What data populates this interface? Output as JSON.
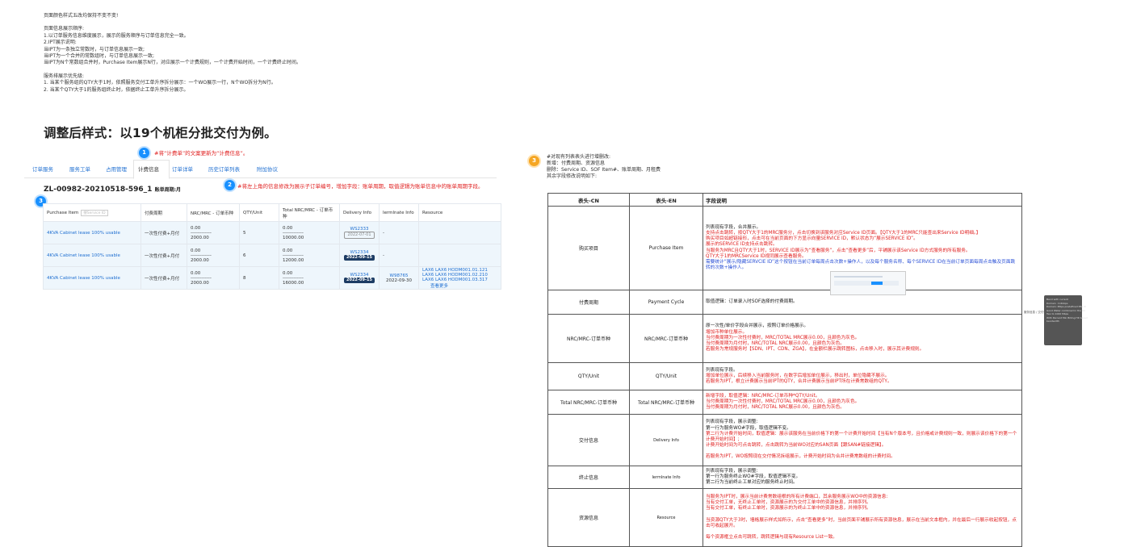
{
  "notes": {
    "line1": "页面颜色样式五改均保持不变不变!",
    "blank1": "",
    "line2": "页面信息展示顺序:",
    "line3": "1.以订单服务信息维度展示，展示的服务顺序与订单信息完全一致。",
    "line4": "2.IPT展示说明:",
    "line5": "当IPT为一条独立常数时，与订单信息展示一致;",
    "line6": "当IPT为一个合并的常数组时，与订单信息展示一致;",
    "line7": "当IPT为N个常数组合并时，Purchase Item展示N行，对应展示一个计费规则，一个计费开始时间，一个计费终止时间。",
    "blank2": "",
    "line8": "服务排展示优先级:",
    "line9": "1. 当某个服务组的QTY大于1时，依照服务交付工单升序拆分展示：一个WO展示一行，N个WO拆分为N行。",
    "line10": "2. 当某个QTY大于1的服务组终止时，依据终止工单升序拆分展示。"
  },
  "heading": "调整后样式：以19个机柜分批交付为例。",
  "badges": {
    "b1": "1",
    "b2": "2",
    "b3": "3",
    "b4": "3"
  },
  "annotations": {
    "a1": "#将“计费单”的文案更新为“计费信息”。",
    "a2": "#将左上角的信息修改为展示子订单编号，增加字段：账单周期，取值逻辑为账单信息中的账单周期字段。",
    "a3_1": "#对现有列表表头进行增删改:",
    "a3_2": "新增：付费周期、资源信息",
    "a3_3": "删除：Service ID、SOF Item#、账单周期、月租费",
    "a3_4": "其余字段修改说明如下:"
  },
  "tabs": [
    "订单服务",
    "服务工单",
    "占用管理",
    "计费信息",
    "订单详单",
    "历史订单列表",
    "附加协议"
  ],
  "order": {
    "id": "ZL-00982-20210518-596_1",
    "cycle_label": "账单周期:月"
  },
  "mock_table": {
    "headers": [
      "Purchase Item",
      "付费周期",
      "NRC/MRC - 订单币种",
      "QTY/Unit",
      "Total NRC/MRC - 订单币种",
      "Delivery Info",
      "Iermlnate Info",
      "Resource"
    ],
    "search_placeholder": "搜Service ID",
    "rows": [
      {
        "item": "4KVA Cabinet lease 100% usable",
        "cycle": "一次性付费+月付",
        "nrc": "0.00",
        "dash": "-------------",
        "mrc": "2000.00",
        "qty": "5",
        "tnrc": "0.00",
        "tdash": "-------------",
        "tmrc": "10000.00",
        "wo": "WS2333",
        "date": "2022-07-01",
        "date_style": "g",
        "term_wo": "",
        "term_date": "",
        "term": "-",
        "res1": "",
        "res2": "",
        "res3": "",
        "more": ""
      },
      {
        "item": "4KVA Cabinet lease 100% usable",
        "cycle": "一次性付费+月付",
        "nrc": "0.00",
        "dash": "-------------",
        "mrc": "2000.00",
        "qty": "6",
        "tnrc": "0.00",
        "tdash": "-------------",
        "tmrc": "12000.00",
        "wo": "WS2334",
        "date": "2022-09-15",
        "date_style": "d",
        "term_wo": "",
        "term_date": "",
        "term": "-",
        "res1": "",
        "res2": "",
        "res3": "",
        "more": ""
      },
      {
        "item": "4KVA Cabinet lease 100% usable",
        "cycle": "一次性付费+月付",
        "nrc": "0.00",
        "dash": "-------------",
        "mrc": "2000.00",
        "qty": "8",
        "tnrc": "0.00",
        "tdash": "-------------",
        "tmrc": "16000.00",
        "wo": "WS2334",
        "date": "2022-09-15",
        "date_style": "d",
        "term_wo": "W98765",
        "term_date": "2022-09-30",
        "term": "",
        "res1": "LAX6 LAX6 HODM001.01.121",
        "res2": "LAX6 LAX6 HODM001.02.210",
        "res3": "LAX6 LAX6 HODM001.03.317",
        "more": "查看更多"
      }
    ]
  },
  "spec_table": {
    "headers": [
      "表头-CN",
      "表头-EN",
      "字段说明"
    ],
    "rows": [
      {
        "cn": "购买项目",
        "en": "Purchase Item",
        "lines": [
          {
            "t": "列表现有字段，合并展示。",
            "c": "k"
          },
          {
            "t": "支持点击跳转，按QTY大于1的MRC服务分，点击切换到该服务对应Service ID页面。【QTY大于1的MRC只能查出来Service ID明细。】",
            "c": "r"
          },
          {
            "t": "购买项目如超链接形，点击可在当前页面的下方显示向量SERVICE ID，默认状态为“展示SERVICE ID”。",
            "c": "r"
          },
          {
            "t": "展示的SERVICE ID支持点击跳转。",
            "c": "r"
          },
          {
            "t": "当服务为MRC且QTY大于1时，SERVICE ID展示为“查看服务”，点击“查看更多”后，平铺展示该Service ID方式服务的所有服务。",
            "c": "r"
          },
          {
            "t": "QTY大于1的MRCService ID视同展示查看服务。",
            "c": "r"
          },
          {
            "t": "需要统计“展示/隐藏SERVCIE ID”这个按钮在当前订单每周点击次数+操作人，以及每个服务名称、每个SERVICE ID在当前订单页面每周点击触及页面跳转的次数+操作人。",
            "c": "b"
          }
        ]
      },
      {
        "cn": "付费周期",
        "en": "Payment Cycle",
        "lines": [
          {
            "t": "取值逻辑：订单录入时SOF选择的付费周期。",
            "c": "k"
          }
        ]
      },
      {
        "cn": "NRC/MRC-订单币种",
        "en": "NRC/MRC-订单币种",
        "lines": [
          {
            "t": "原一次性/单价字段合并展示，按照订单价格展示。",
            "c": "k"
          },
          {
            "t": "增加币种单位展示。",
            "c": "r"
          },
          {
            "t": "当付费周期为一次性付费时，MRC/TOTAL MRC展示0.00，且颜色为灰色。",
            "c": "r"
          },
          {
            "t": "当付费周期为月付时，NRC/TOTAL NRC展示0.00，且颜色为灰色。",
            "c": "r"
          },
          {
            "t": "若服务为常规服务时【SDN、IPT、CDN、ZGA】，在金额栏展示跳转图标，点击移入时，展示其计费规则。",
            "c": "r"
          }
        ]
      },
      {
        "cn": "QTY/Unit",
        "en": "QTY/Unit",
        "lines": [
          {
            "t": "列表现有字段。",
            "c": "k"
          },
          {
            "t": "增加单位展示，后续移入当前服务时，在数字后增加单位展示，移出时，单位隐藏不展示。",
            "c": "r"
          },
          {
            "t": "若服务为IPT，根立计费展示当前IPT的QTY，合并计费展示当前IPT所在计费常数组的QTY。",
            "c": "r"
          }
        ]
      },
      {
        "cn": "Total NRC/MRC-订单币种",
        "en": "Total NRC/MRC-订单币种",
        "lines": [
          {
            "t": "新增字段，取值逻辑：NRC/MRC-订单币种*QTY/Unit。",
            "c": "r"
          },
          {
            "t": "当付费周期为一次性付费时，MRC/TOTAL MRC展示0.00，且颜色为灰色。",
            "c": "r"
          },
          {
            "t": "当付费周期为月付时，NRC/TOTAL NRC展示0.00，且颜色为灰色。",
            "c": "r"
          }
        ]
      },
      {
        "cn": "交付信息",
        "en": "Delivery Info",
        "lines": [
          {
            "t": "列表现有字段，展示调整:",
            "c": "k"
          },
          {
            "t": "第一行为服务WO#字段，取值逻辑不变。",
            "c": "k"
          },
          {
            "t": "第二行为计费开始时间，取值逻辑：展示该服务在当前价格下的第一个计费开始时间【当有N个版本号，且价格或计费规则一致，则展示该价格下的第一个计费开始时间】;",
            "c": "r"
          },
          {
            "t": "计费开始时间为可点击跳转，点击跳转为当前WO对应的SAN页面【跟SAN#链接逻辑】。",
            "c": "r"
          },
          {
            "t": "",
            "c": "k"
          },
          {
            "t": "若服务为IPT，WO按照现在交付情况拆组展示，计费开始时间为合并计费常数组的计费时间。",
            "c": "r"
          }
        ]
      },
      {
        "cn": "终止信息",
        "en": "Iermlnate Info",
        "lines": [
          {
            "t": "列表现有字段，展示调整:",
            "c": "k"
          },
          {
            "t": "第一行为服务终止WO#字段，取值逻辑不变。",
            "c": "k"
          },
          {
            "t": "第二行为当前终止工单对应的服务终止时间。",
            "c": "k"
          }
        ]
      },
      {
        "cn": "资源信息",
        "en": "Resource",
        "lines": [
          {
            "t": "当服务为IPT时，展示当前计费常数组根的所有计费端口，其余服务展示WO中的资源信息:",
            "c": "r"
          },
          {
            "t": "当有交付工单，无终止工单时，资源展示的为交付工单中的资源信息，并排序列。",
            "c": "r"
          },
          {
            "t": "当有交付工单，有终止工单时，资源展示的为终止工单中的资源信息，并排序列。",
            "c": "r"
          },
          {
            "t": "",
            "c": "k"
          },
          {
            "t": "当资源QTY大于3时，墙格展示样式如所示，点击“查看更多”时，当前页面平铺展示所有资源信息，展示在当前文本框内，并在最后一行展示收起按钮，点击可收起展开。",
            "c": "r"
          },
          {
            "t": "",
            "c": "k"
          },
          {
            "t": "每个资源框立点击可跳转，跳转逻辑与现有Resource List一致。",
            "c": "r"
          }
        ]
      }
    ]
  },
  "side": {
    "label": "服务信息 / 交付信息",
    "card": "Band with current\nDomain : 0.6kbps\nDomain: Pi6ps predefined P6s W\nGood Water combined in the V2\nTwo to 1000 Mbps\nWith Percent Min Billing Hit based\nbandwidth"
  },
  "colors": {
    "accent": "#1890ff",
    "badge_orange": "#f5a623",
    "red_text": "#e02020",
    "blue_text": "#1f6fd1",
    "date_dark": "#1d3c64"
  }
}
